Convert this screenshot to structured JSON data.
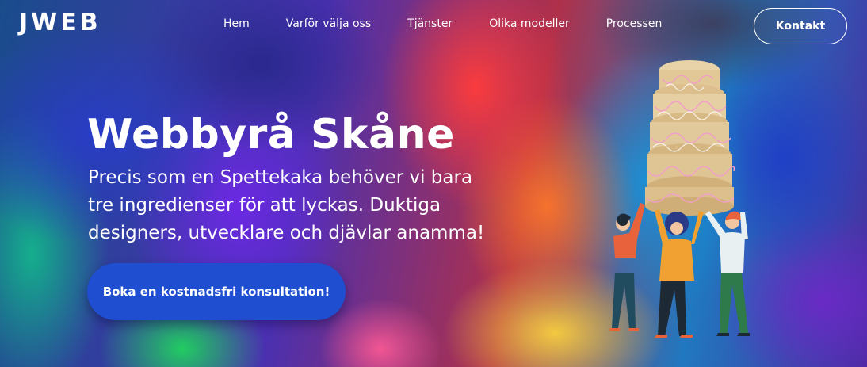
{
  "header": {
    "logo": "JWEB",
    "nav": [
      "Hem",
      "Varför välja oss",
      "Tjänster",
      "Olika modeller",
      "Processen"
    ],
    "contact_label": "Kontakt"
  },
  "hero": {
    "title": "Webbyrå Skåne",
    "subtitle": "Precis som en Spettekaka behöver vi bara tre ingredienser för att lyckas. Duktiga designers, utvecklare och djävlar anamma!",
    "cta_label": "Boka en kostnadsfri konsultation!",
    "illustration_icon": "spettekaka-team-illustration"
  },
  "colors": {
    "cta": "#1f4fd0",
    "text": "#ffffff"
  }
}
